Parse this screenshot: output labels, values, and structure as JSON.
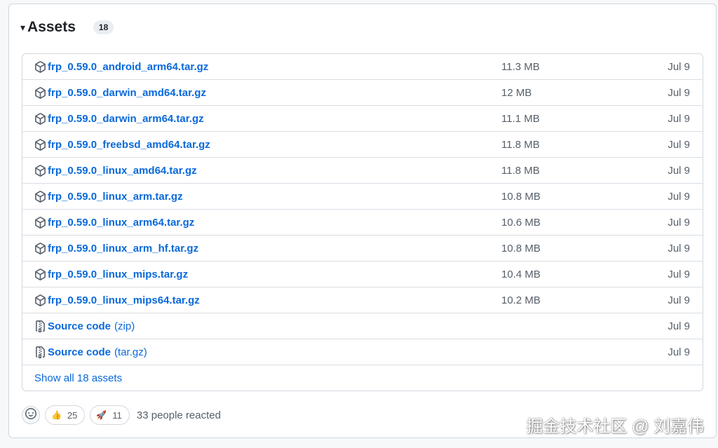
{
  "assets": {
    "caret": "▾",
    "title": "Assets",
    "count": "18",
    "items": [
      {
        "name": "frp_0.59.0_android_arm64.tar.gz",
        "suffix": "",
        "size": "11.3 MB",
        "date": "Jul 9",
        "icon": "package-icon"
      },
      {
        "name": "frp_0.59.0_darwin_amd64.tar.gz",
        "suffix": "",
        "size": "12 MB",
        "date": "Jul 9",
        "icon": "package-icon"
      },
      {
        "name": "frp_0.59.0_darwin_arm64.tar.gz",
        "suffix": "",
        "size": "11.1 MB",
        "date": "Jul 9",
        "icon": "package-icon"
      },
      {
        "name": "frp_0.59.0_freebsd_amd64.tar.gz",
        "suffix": "",
        "size": "11.8 MB",
        "date": "Jul 9",
        "icon": "package-icon"
      },
      {
        "name": "frp_0.59.0_linux_amd64.tar.gz",
        "suffix": "",
        "size": "11.8 MB",
        "date": "Jul 9",
        "icon": "package-icon"
      },
      {
        "name": "frp_0.59.0_linux_arm.tar.gz",
        "suffix": "",
        "size": "10.8 MB",
        "date": "Jul 9",
        "icon": "package-icon"
      },
      {
        "name": "frp_0.59.0_linux_arm64.tar.gz",
        "suffix": "",
        "size": "10.6 MB",
        "date": "Jul 9",
        "icon": "package-icon"
      },
      {
        "name": "frp_0.59.0_linux_arm_hf.tar.gz",
        "suffix": "",
        "size": "10.8 MB",
        "date": "Jul 9",
        "icon": "package-icon"
      },
      {
        "name": "frp_0.59.0_linux_mips.tar.gz",
        "suffix": "",
        "size": "10.4 MB",
        "date": "Jul 9",
        "icon": "package-icon"
      },
      {
        "name": "frp_0.59.0_linux_mips64.tar.gz",
        "suffix": "",
        "size": "10.2 MB",
        "date": "Jul 9",
        "icon": "package-icon"
      },
      {
        "name": "Source code",
        "suffix": "(zip)",
        "size": "",
        "date": "Jul 9",
        "icon": "file-zip-icon"
      },
      {
        "name": "Source code",
        "suffix": "(tar.gz)",
        "size": "",
        "date": "Jul 9",
        "icon": "file-zip-icon"
      }
    ],
    "show_all": "Show all 18 assets"
  },
  "reactions": {
    "items": [
      {
        "emoji": "👍",
        "count": "25",
        "icon": "thumbs-up-icon"
      },
      {
        "emoji": "🚀",
        "count": "11",
        "icon": "rocket-icon"
      }
    ],
    "summary": "33 people reacted"
  },
  "watermark": "掘金技术社区 @ 刘嘉伟",
  "colors": {
    "link": "#0969da",
    "muted": "#57606a",
    "border": "#d0d7de"
  }
}
